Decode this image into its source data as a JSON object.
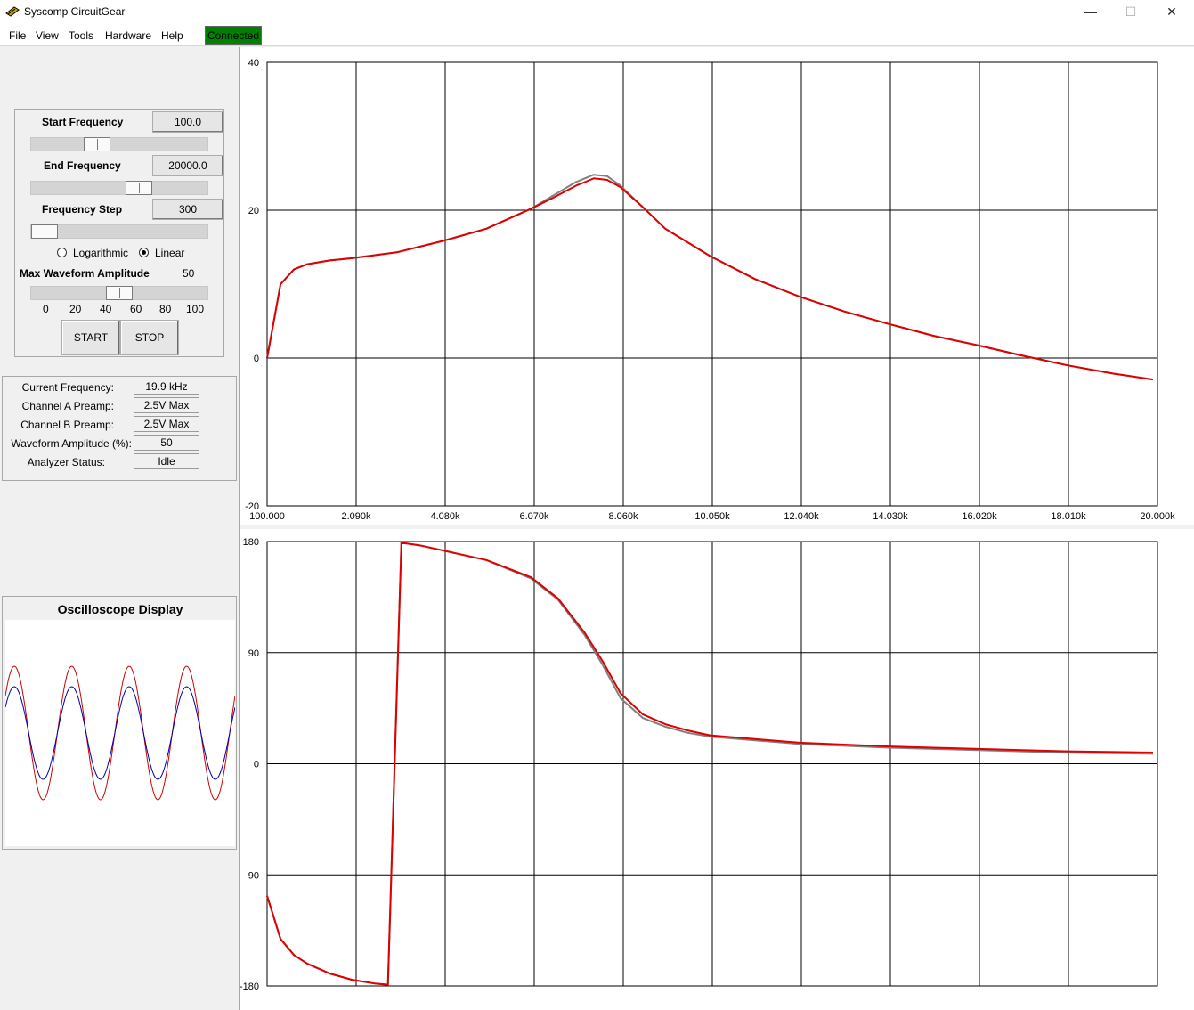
{
  "window": {
    "title": "Syscomp CircuitGear",
    "minimize": "—",
    "maximize": "☐",
    "close": "✕"
  },
  "menu": [
    "File",
    "View",
    "Tools",
    "Hardware",
    "Help"
  ],
  "connection_status": "Connected",
  "controls": {
    "start_frequency_label": "Start Frequency",
    "start_frequency_value": "100.0",
    "start_slider_level": 0.35,
    "end_frequency_label": "End Frequency",
    "end_frequency_value": "20000.0",
    "end_slider_level": 0.63,
    "frequency_step_label": "Frequency Step",
    "frequency_step_value": "300",
    "step_slider_level": 0.0,
    "sweep_modes": [
      "Logarithmic",
      "Linear"
    ],
    "selected_mode": "Linear",
    "max_amplitude_label": "Max Waveform Amplitude",
    "max_amplitude_value": "50",
    "amplitude_slider_level": 0.5,
    "amplitude_scale": [
      "0",
      "20",
      "40",
      "60",
      "80",
      "100"
    ],
    "start_button": "START",
    "stop_button": "STOP"
  },
  "status": [
    {
      "label": "Current Frequency:",
      "value": "19.9 kHz"
    },
    {
      "label": "Channel A Preamp:",
      "value": "2.5V Max"
    },
    {
      "label": "Channel B Preamp:",
      "value": "2.5V Max"
    },
    {
      "label": "Waveform Amplitude (%):",
      "value": "50"
    },
    {
      "label": "Analyzer Status:",
      "value": "Idle"
    }
  ],
  "oscilloscope": {
    "title": "Oscilloscope Display",
    "colors": {
      "channel_a": "#cc0000",
      "channel_b": "#0000aa"
    }
  },
  "icons": {
    "app": "circuitgear-app-icon"
  },
  "colors": {
    "connected": "#008000",
    "trace_primary": "#e00000",
    "trace_secondary": "#808080",
    "grid": "#000000"
  },
  "chart_data": [
    {
      "type": "line",
      "xlabel": "",
      "ylabel": "",
      "x_ticks": [
        "100.000",
        "2.090k",
        "4.080k",
        "6.070k",
        "8.060k",
        "10.050k",
        "12.040k",
        "14.030k",
        "16.020k",
        "18.010k",
        "20.000k"
      ],
      "y_ticks": [
        "40",
        "20",
        "0",
        "-20"
      ],
      "xlim": [
        100,
        20000
      ],
      "ylim": [
        -20,
        40
      ],
      "grid": true,
      "series": [
        {
          "color": "#808080",
          "x": [
            100,
            400,
            700,
            1000,
            1500,
            2000,
            3000,
            4000,
            5000,
            6000,
            6500,
            7000,
            7200,
            7400,
            7700,
            8000,
            8500,
            9000,
            10000,
            11000,
            12000,
            13000,
            14000,
            15000,
            16000,
            17000,
            18000,
            19000,
            19900
          ],
          "y": [
            0,
            10,
            12,
            12.7,
            13.2,
            13.5,
            14.3,
            15.8,
            17.5,
            20.2,
            22,
            23.8,
            24.3,
            24.8,
            24.6,
            23.3,
            20.4,
            17.5,
            13.8,
            10.7,
            8.3,
            6.3,
            4.6,
            3,
            1.7,
            0.3,
            -1,
            -2.1,
            -2.9
          ]
        },
        {
          "color": "#e00000",
          "x": [
            100,
            400,
            700,
            1000,
            1500,
            2000,
            3000,
            4000,
            5000,
            6000,
            6500,
            7000,
            7200,
            7400,
            7700,
            8000,
            8500,
            9000,
            10000,
            11000,
            12000,
            13000,
            14000,
            15000,
            16000,
            17000,
            18000,
            19000,
            19900
          ],
          "y": [
            0,
            10,
            12,
            12.7,
            13.2,
            13.5,
            14.3,
            15.8,
            17.5,
            20.2,
            21.7,
            23.3,
            23.8,
            24.3,
            24.1,
            23.1,
            20.4,
            17.5,
            13.8,
            10.7,
            8.3,
            6.3,
            4.6,
            3,
            1.7,
            0.3,
            -1,
            -2.1,
            -2.9
          ]
        }
      ]
    },
    {
      "type": "line",
      "xlabel": "",
      "ylabel": "",
      "x_ticks": [],
      "y_ticks": [
        "180",
        "90",
        "0",
        "-90",
        "-180"
      ],
      "xlim": [
        100,
        20000
      ],
      "ylim": [
        -180,
        180
      ],
      "grid": true,
      "series": [
        {
          "color": "#808080",
          "x": [
            100,
            400,
            700,
            1000,
            1500,
            2000,
            2500,
            2800,
            3100,
            3500,
            4000,
            5000,
            6000,
            6600,
            7200,
            7600,
            8000,
            8500,
            9000,
            9500,
            10000,
            11000,
            12000,
            14000,
            16000,
            18000,
            19900
          ],
          "y": [
            -107,
            -142,
            -155,
            -162,
            -170,
            -175,
            -178,
            -179,
            179,
            177,
            173,
            165,
            150,
            133,
            104,
            80,
            53,
            37,
            30,
            25,
            22,
            19,
            16,
            13,
            11,
            9,
            8
          ]
        },
        {
          "color": "#e00000",
          "x": [
            100,
            400,
            700,
            1000,
            1500,
            2000,
            2500,
            2800,
            3100,
            3500,
            4000,
            5000,
            6000,
            6600,
            7200,
            7600,
            8000,
            8500,
            9000,
            9500,
            10000,
            11000,
            12000,
            14000,
            16000,
            18000,
            19900
          ],
          "y": [
            -107,
            -142,
            -155,
            -162,
            -170,
            -175,
            -178,
            -179,
            179,
            177,
            173,
            165,
            151,
            134,
            106,
            83,
            57,
            40,
            32,
            27,
            23,
            20,
            17,
            14,
            12,
            10,
            9
          ]
        }
      ]
    }
  ]
}
